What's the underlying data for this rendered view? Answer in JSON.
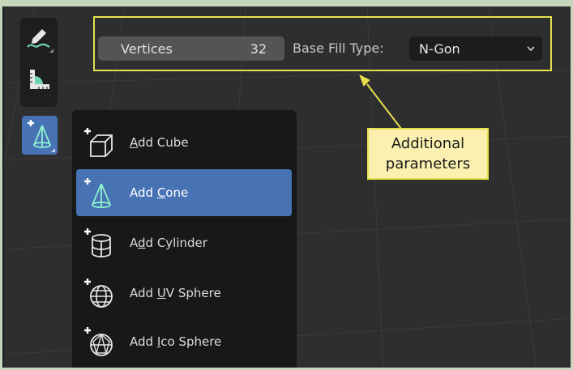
{
  "toolbar": {
    "tools": [
      {
        "name": "annotate-tool",
        "icon": "annotate-pencil-icon"
      },
      {
        "name": "measure-tool",
        "icon": "ruler-icon"
      },
      {
        "name": "add-cone-tool",
        "icon": "add-cone-icon",
        "active": true
      }
    ]
  },
  "header": {
    "vertices_label": "Vertices",
    "vertices_value": "32",
    "fill_type_label": "Base Fill Type:",
    "fill_type_value": "N-Gon",
    "dropdown_icon": "chevron-down-icon"
  },
  "callout": {
    "line1": "Additional",
    "line2": "parameters"
  },
  "menu": {
    "items": [
      {
        "pre": "",
        "u": "A",
        "post": "dd Cube",
        "icon": "add-cube-icon"
      },
      {
        "pre": "Add ",
        "u": "C",
        "post": "one",
        "icon": "add-cone-icon",
        "active": true
      },
      {
        "pre": "A",
        "u": "d",
        "post": "d Cylinder",
        "icon": "add-cylinder-icon"
      },
      {
        "pre": "Add ",
        "u": "U",
        "post": "V Sphere",
        "icon": "add-uv-sphere-icon"
      },
      {
        "pre": "Add ",
        "u": "I",
        "post": "co Sphere",
        "icon": "add-ico-sphere-icon"
      }
    ]
  },
  "colors": {
    "accent": "#4772b3",
    "highlight_outline": "#e7e04c",
    "callout_bg": "#fbf0b0",
    "icon_green": "#6fd3b1"
  }
}
